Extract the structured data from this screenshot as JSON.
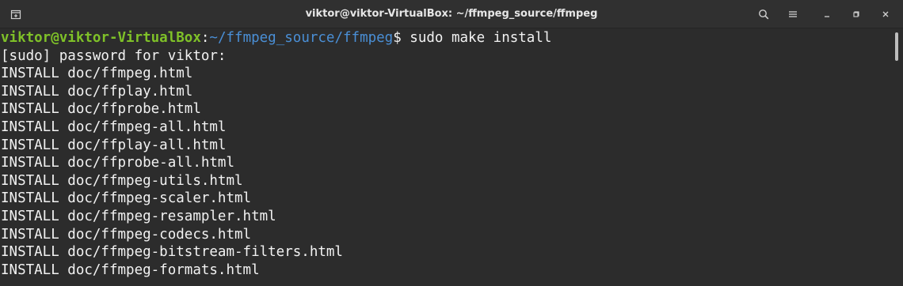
{
  "window": {
    "title": "viktor@viktor-VirtualBox: ~/ffmpeg_source/ffmpeg"
  },
  "titlebar": {
    "icons": {
      "new_tab": "new-tab-icon",
      "search": "search-icon",
      "menu": "hamburger-menu-icon",
      "minimize": "minimize-icon",
      "maximize": "maximize-icon",
      "close": "close-icon"
    }
  },
  "terminal": {
    "prompt": {
      "user_host": "viktor@viktor-VirtualBox",
      "colon": ":",
      "path": "~/ffmpeg_source/ffmpeg",
      "dollar": "$",
      "command": " sudo make install"
    },
    "output": [
      "[sudo] password for viktor:",
      "INSTALL doc/ffmpeg.html",
      "INSTALL doc/ffplay.html",
      "INSTALL doc/ffprobe.html",
      "INSTALL doc/ffmpeg-all.html",
      "INSTALL doc/ffplay-all.html",
      "INSTALL doc/ffprobe-all.html",
      "INSTALL doc/ffmpeg-utils.html",
      "INSTALL doc/ffmpeg-scaler.html",
      "INSTALL doc/ffmpeg-resampler.html",
      "INSTALL doc/ffmpeg-codecs.html",
      "INSTALL doc/ffmpeg-bitstream-filters.html",
      "INSTALL doc/ffmpeg-formats.html"
    ]
  },
  "colors": {
    "background": "#2c2c2c",
    "prompt_user": "#7fc128",
    "prompt_path": "#4a8fd6",
    "text": "#f2f2f2"
  }
}
